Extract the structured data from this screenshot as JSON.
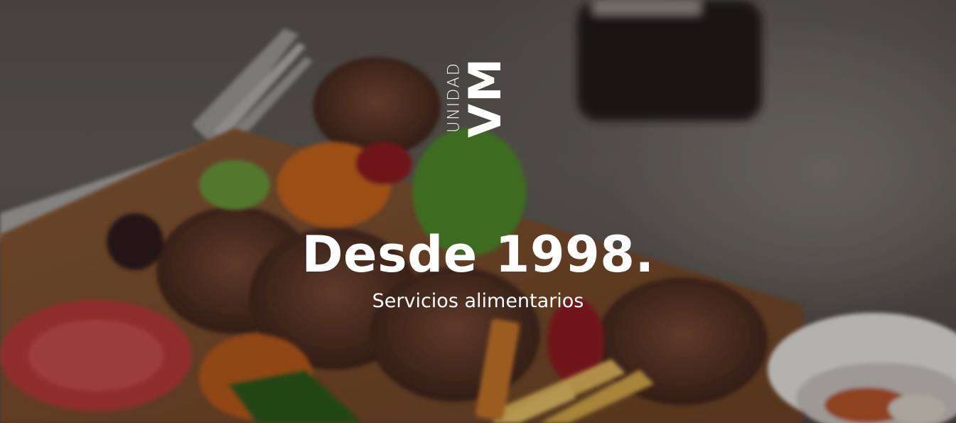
{
  "brand": {
    "unidad": "UNIDAD",
    "vm": "VM"
  },
  "hero": {
    "headline": "Desde 1998.",
    "subheadline": "Servicios alimentarios"
  },
  "colors": {
    "text": "#ffffff",
    "overlay": "#000000"
  }
}
